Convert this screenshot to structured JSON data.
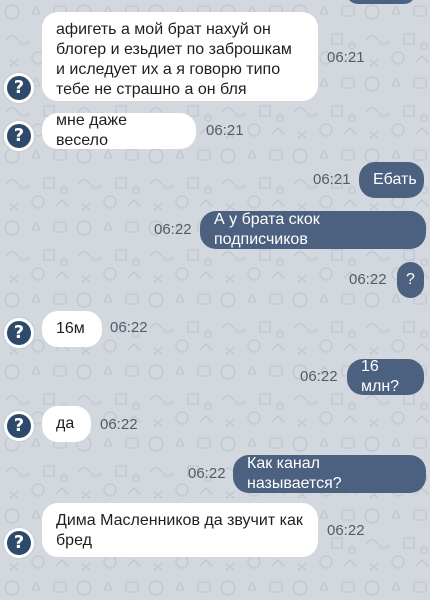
{
  "conversation": {
    "messages": [
      {
        "direction": "in",
        "text": "афигеть а мой брат нахуй он блогер и езьдиет по заброшкам и иследует их а я говорю типо тебе не страшно а он бля",
        "time": "06:21"
      },
      {
        "direction": "in",
        "text": "мне даже весело",
        "time": "06:21"
      },
      {
        "direction": "out",
        "text": "Ебать",
        "time": "06:21"
      },
      {
        "direction": "out",
        "text": "А у брата скок подписчиков",
        "time": "06:22"
      },
      {
        "direction": "out",
        "text": "?",
        "time": "06:22"
      },
      {
        "direction": "in",
        "text": "16м",
        "time": "06:22"
      },
      {
        "direction": "out",
        "text": "16 млн?",
        "time": "06:22"
      },
      {
        "direction": "in",
        "text": "да",
        "time": "06:22"
      },
      {
        "direction": "out",
        "text": "Как канал называется?",
        "time": "06:22"
      },
      {
        "direction": "in",
        "text": "Дима Масленников да звучит как бред",
        "time": "06:22"
      }
    ],
    "avatar_symbol": "?"
  },
  "colors": {
    "background": "#d3d8de",
    "incoming_bubble": "#ffffff",
    "outgoing_bubble": "#4c6180",
    "timestamp": "#555c66",
    "avatar": "#2e4a6b"
  }
}
